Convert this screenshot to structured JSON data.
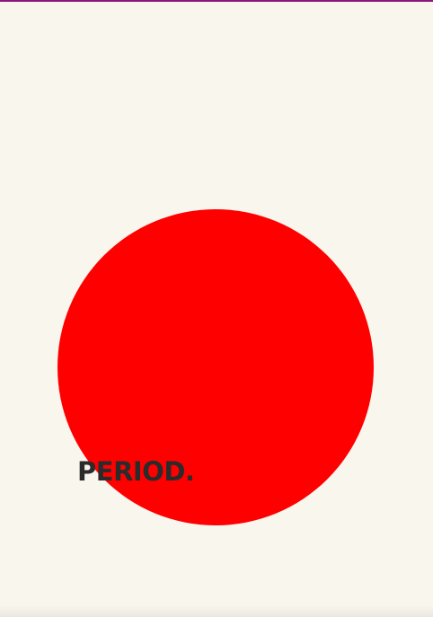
{
  "poster": {
    "word": "PERIOD.",
    "colors": {
      "background": "#f9f6ee",
      "circle": "#ff0000",
      "text": "#2b2b2b",
      "top_bar": "#8a1a7a"
    }
  }
}
